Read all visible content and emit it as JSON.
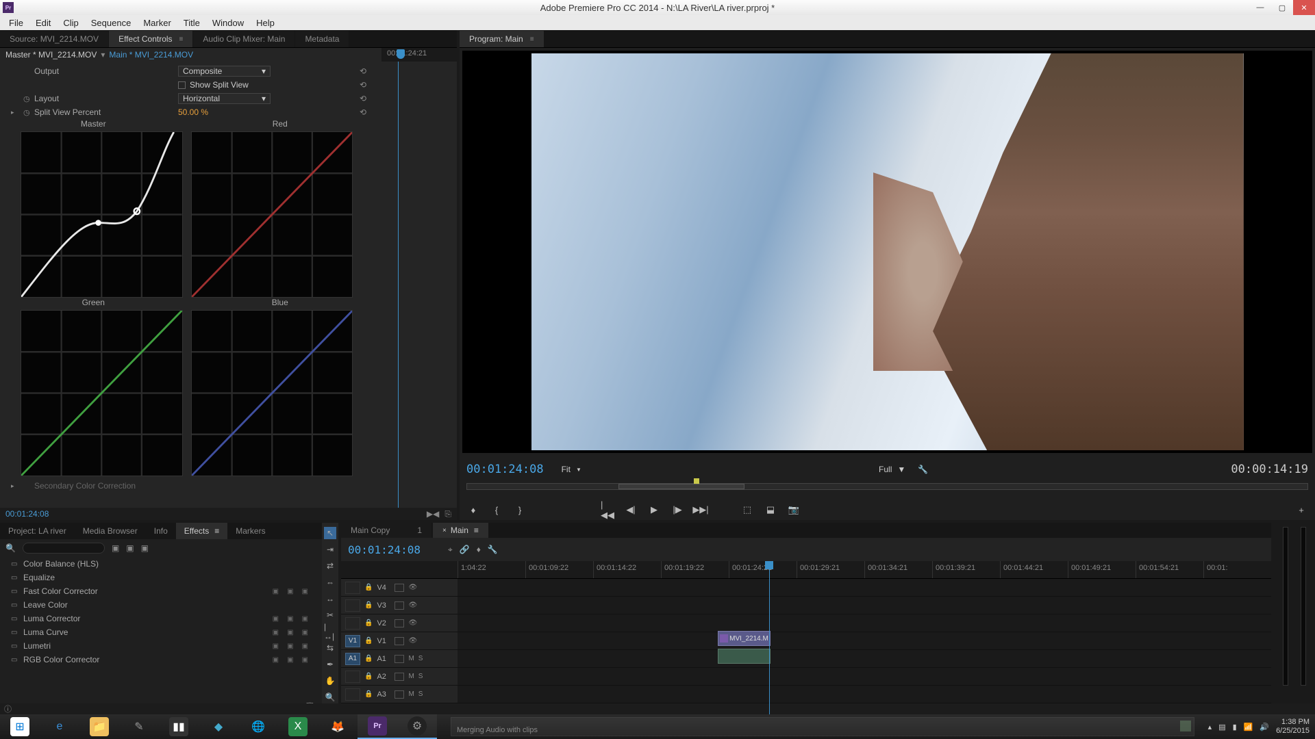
{
  "title": "Adobe Premiere Pro CC 2014 - N:\\LA River\\LA river.prproj *",
  "menu": [
    "File",
    "Edit",
    "Clip",
    "Sequence",
    "Marker",
    "Title",
    "Window",
    "Help"
  ],
  "sourceTabs": [
    "Source: MVI_2214.MOV",
    "Effect Controls",
    "Audio Clip Mixer: Main",
    "Metadata"
  ],
  "ecHeader": {
    "master": "Master * MVI_2214.MOV",
    "clip": "Main * MVI_2214.MOV"
  },
  "ecTimelineTc": "00:01:24:21",
  "ecProps": {
    "output": {
      "label": "Output",
      "value": "Composite"
    },
    "split": {
      "label": "Show Split View"
    },
    "layout": {
      "label": "Layout",
      "value": "Horizontal"
    },
    "splitPercent": {
      "label": "Split View Percent",
      "value": "50.00 %"
    }
  },
  "curveLabels": [
    "Master",
    "Red",
    "Green",
    "Blue"
  ],
  "secondary": "Secondary Color Correction",
  "ecFooterTc": "00:01:24:08",
  "programTab": "Program: Main",
  "programTcLeft": "00:01:24:08",
  "programZoom": "Fit",
  "programRes": "Full",
  "programTcRight": "00:00:14:19",
  "projectTabs": [
    "Project: LA river",
    "Media Browser",
    "Info",
    "Effects",
    "Markers"
  ],
  "projectSearch": "",
  "effects": [
    {
      "n": "Color Balance (HLS)",
      "b": false
    },
    {
      "n": "Equalize",
      "b": false
    },
    {
      "n": "Fast Color Corrector",
      "b": true
    },
    {
      "n": "Leave Color",
      "b": false
    },
    {
      "n": "Luma Corrector",
      "b": true
    },
    {
      "n": "Luma Curve",
      "b": true
    },
    {
      "n": "Lumetri",
      "b": true
    },
    {
      "n": "RGB Color Corrector",
      "b": true
    }
  ],
  "timelineTabs": [
    {
      "label": "Main Copy",
      "count": "1"
    },
    {
      "label": "Main",
      "active": true
    }
  ],
  "timelineTc": "00:01:24:08",
  "timelineRuler": [
    "1:04:22",
    "00:01:09:22",
    "00:01:14:22",
    "00:01:19:22",
    "00:01:24:21",
    "00:01:29:21",
    "00:01:34:21",
    "00:01:39:21",
    "00:01:44:21",
    "00:01:49:21",
    "00:01:54:21",
    "00:01:"
  ],
  "tracks": {
    "video": [
      "V4",
      "V3",
      "V2",
      "V1"
    ],
    "audio": [
      "A1",
      "A2",
      "A3"
    ]
  },
  "srcPatches": {
    "V1": "V1",
    "A1": "A1"
  },
  "clipName": "MVI_2214.M",
  "meterLabel": "S",
  "taskbar": {
    "time": "1:38 PM",
    "date": "6/25/2015",
    "tooltip": "Merging Audio with clips"
  }
}
